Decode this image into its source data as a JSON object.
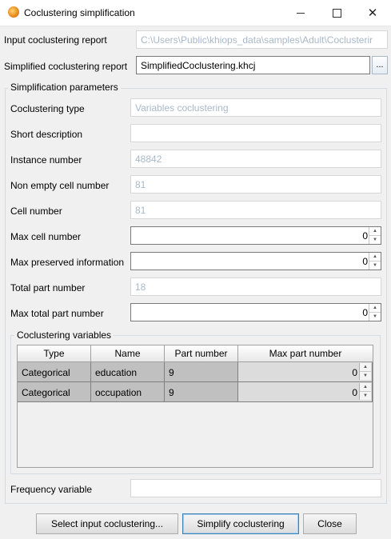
{
  "window": {
    "title": "Coclustering simplification",
    "icon": "app-icon",
    "controls": [
      "minimize-icon",
      "maximize-icon",
      "close-icon"
    ]
  },
  "form": {
    "input_report": {
      "label": "Input coclustering report",
      "value": "C:\\Users\\Public\\khiops_data\\samples\\Adult\\Coclusterir"
    },
    "simplified_report": {
      "label": "Simplified coclustering report",
      "value": "SimplifiedCoclustering.khcj",
      "browse_label": "..."
    }
  },
  "params": {
    "title": "Simplification parameters",
    "coclustering_type": {
      "label": "Coclustering type",
      "value": "Variables coclustering"
    },
    "short_description": {
      "label": "Short description",
      "value": ""
    },
    "instance_number": {
      "label": "Instance number",
      "value": "48842"
    },
    "non_empty_cell_number": {
      "label": "Non empty cell number",
      "value": "81"
    },
    "cell_number": {
      "label": "Cell number",
      "value": "81"
    },
    "max_cell_number": {
      "label": "Max cell number",
      "value": "0"
    },
    "max_preserved_information": {
      "label": "Max preserved information",
      "value": "0"
    },
    "total_part_number": {
      "label": "Total part number",
      "value": "18"
    },
    "max_total_part_number": {
      "label": "Max total part number",
      "value": "0"
    }
  },
  "variables": {
    "title": "Coclustering variables",
    "headers": [
      "Type",
      "Name",
      "Part number",
      "Max part number"
    ],
    "rows": [
      {
        "type": "Categorical",
        "name": "education",
        "part_number": "9",
        "max_part_number": "0"
      },
      {
        "type": "Categorical",
        "name": "occupation",
        "part_number": "9",
        "max_part_number": "0"
      }
    ]
  },
  "frequency_variable": {
    "label": "Frequency variable",
    "value": ""
  },
  "buttons": {
    "select_input": "Select input coclustering...",
    "simplify": "Simplify coclustering",
    "close": "Close"
  }
}
